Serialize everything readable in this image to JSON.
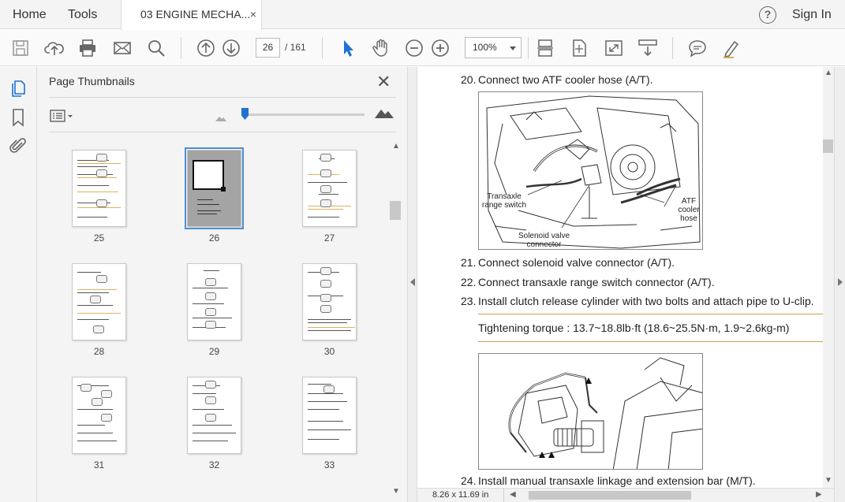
{
  "menubar": {
    "home_label": "Home",
    "tools_label": "Tools",
    "tab_title": "03 ENGINE MECHA...",
    "tab_close": "×",
    "help_glyph": "?",
    "signin_label": "Sign In"
  },
  "toolbar": {
    "current_page": "26",
    "page_total": "/  161",
    "zoom": "100%",
    "icons": [
      "save-icon",
      "cloud-upload-icon",
      "print-icon",
      "email-icon",
      "search-icon",
      "prev-page-icon",
      "next-page-icon",
      "select-tool-icon",
      "hand-tool-icon",
      "zoom-out-icon",
      "zoom-in-icon",
      "fit-width-icon",
      "fit-page-icon",
      "full-screen-icon",
      "scrolling-mode-icon",
      "comment-icon",
      "highlight-pen-icon"
    ]
  },
  "rail": {
    "icons": [
      "page-thumbnails-icon",
      "bookmarks-icon",
      "attachments-icon"
    ]
  },
  "thumbnails_panel": {
    "title": "Page Thumbnails",
    "close_glyph": "✕",
    "selected_page": "26",
    "pages": [
      "25",
      "26",
      "27",
      "28",
      "29",
      "30",
      "31",
      "32",
      "33"
    ]
  },
  "document": {
    "steps": [
      {
        "num": "20.",
        "text": "Connect two ATF cooler hose (A/T)."
      },
      {
        "num": "21.",
        "text": "Connect solenoid valve connector (A/T)."
      },
      {
        "num": "22.",
        "text": "Connect transaxle range switch connector (A/T)."
      },
      {
        "num": "23.",
        "text": "Install clutch release cylinder with two bolts and attach pipe to U-clip."
      },
      {
        "num": "24.",
        "text": "Install manual transaxle linkage and extension bar (M/T)."
      }
    ],
    "figure1_labels": {
      "range_switch_1": "Transaxle",
      "range_switch_2": "range switch",
      "solenoid_1": "Solenoid valve",
      "solenoid_2": "connector",
      "atf_1": "ATF",
      "atf_2": "cooler",
      "atf_3": "hose"
    },
    "torque_note": "Tightening torque : 13.7~18.8lb·ft (18.6~25.5N·m, 1.9~2.6kg-m)"
  },
  "statusbar": {
    "page_size": "8.26 x 11.69 in"
  }
}
